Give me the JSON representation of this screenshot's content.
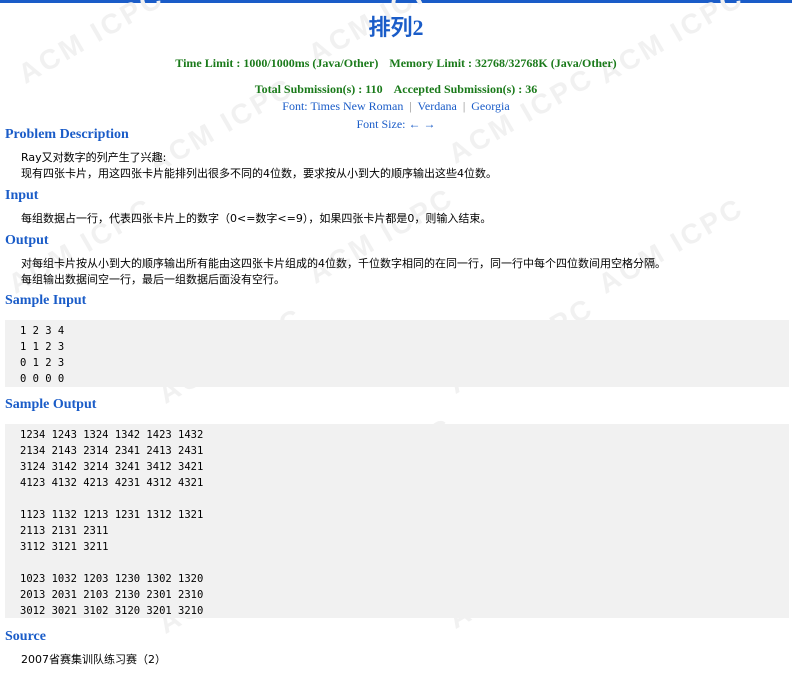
{
  "problem": {
    "title": "排列2",
    "time_limit": "Time Limit : 1000/1000ms (Java/Other)",
    "memory_limit": "Memory Limit : 32768/32768K (Java/Other)",
    "total_submissions": "Total Submission(s) : 110",
    "accepted_submissions": "Accepted Submission(s) : 36"
  },
  "font_selector": {
    "label": "Font:",
    "options": [
      "Times New Roman",
      "Verdana",
      "Georgia"
    ],
    "separator": "|",
    "size_label": "Font Size:",
    "decrease": "←",
    "increase": "→"
  },
  "watermark_text": "ACM ICPC",
  "sections": {
    "description": {
      "title": "Problem Description",
      "lines": [
        "Ray又对数字的列产生了兴趣:",
        "现有四张卡片，用这四张卡片能排列出很多不同的4位数，要求按从小到大的顺序输出这些4位数。"
      ]
    },
    "input": {
      "title": "Input",
      "lines": [
        "每组数据占一行，代表四张卡片上的数字（0<=数字<=9），如果四张卡片都是0，则输入结束。"
      ]
    },
    "output": {
      "title": "Output",
      "lines": [
        "对每组卡片按从小到大的顺序输出所有能由这四张卡片组成的4位数，千位数字相同的在同一行，同一行中每个四位数间用空格分隔。",
        "每组输出数据间空一行，最后一组数据后面没有空行。"
      ]
    },
    "sample_input": {
      "title": "Sample Input",
      "text": "1 2 3 4\n1 1 2 3\n0 1 2 3\n0 0 0 0"
    },
    "sample_output": {
      "title": "Sample Output",
      "text": "1234 1243 1324 1342 1423 1432\n2134 2143 2314 2341 2413 2431\n3124 3142 3214 3241 3412 3421\n4123 4132 4213 4231 4312 4321\n\n1123 1132 1213 1231 1312 1321\n2113 2131 2311\n3112 3121 3211\n\n1023 1032 1203 1230 1302 1320\n2013 2031 2103 2130 2301 2310\n3012 3021 3102 3120 3201 3210"
    },
    "source": {
      "title": "Source",
      "text": "2007省赛集训队练习赛（2）"
    }
  }
}
